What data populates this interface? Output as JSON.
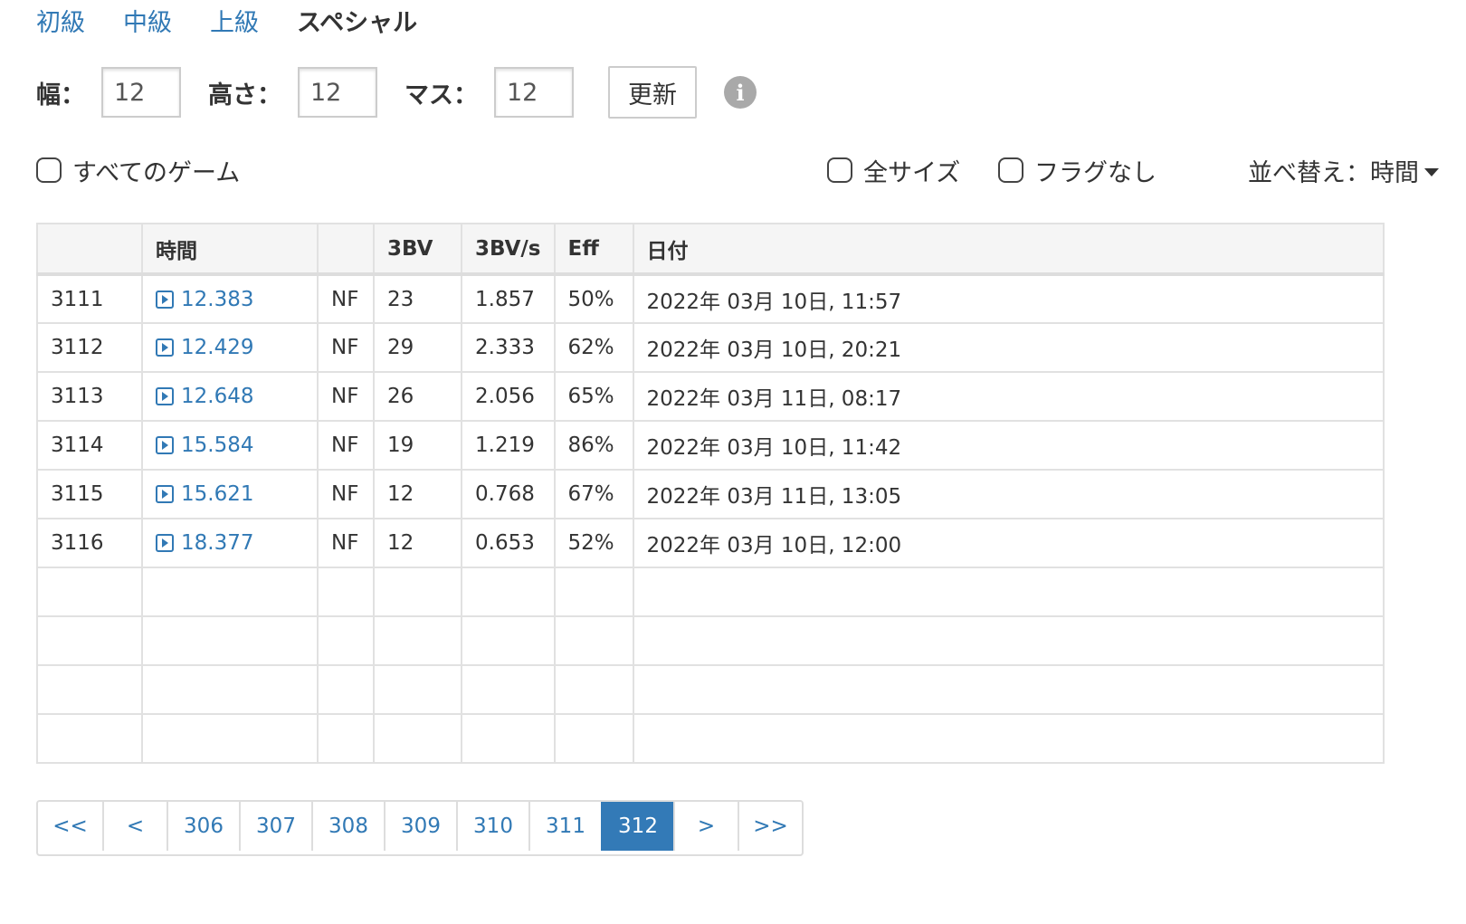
{
  "levels": [
    {
      "label": "初級",
      "active": false
    },
    {
      "label": "中級",
      "active": false
    },
    {
      "label": "上級",
      "active": false
    },
    {
      "label": "スペシャル",
      "active": true
    }
  ],
  "size_controls": {
    "width_label": "幅：",
    "width_value": "12",
    "height_label": "高さ：",
    "height_value": "12",
    "mines_label": "マス：",
    "mines_value": "12",
    "update_label": "更新",
    "info_icon": "info-circle-icon"
  },
  "filters": {
    "all_games_label": "すべてのゲーム",
    "all_games_checked": false,
    "all_sizes_label": "全サイズ",
    "all_sizes_checked": false,
    "no_flags_label": "フラグなし",
    "no_flags_checked": false,
    "sort_label": "並べ替え：時間"
  },
  "table": {
    "headers": [
      "",
      "時間",
      "",
      "3BV",
      "3BV/s",
      "Eff",
      "日付"
    ],
    "rows": [
      {
        "rank": "3111",
        "time": "12.383",
        "nf": "NF",
        "bv": "23",
        "bvs": "1.857",
        "eff": "50%",
        "date": "2022年 03月 10日, 11:57"
      },
      {
        "rank": "3112",
        "time": "12.429",
        "nf": "NF",
        "bv": "29",
        "bvs": "2.333",
        "eff": "62%",
        "date": "2022年 03月 10日, 20:21"
      },
      {
        "rank": "3113",
        "time": "12.648",
        "nf": "NF",
        "bv": "26",
        "bvs": "2.056",
        "eff": "65%",
        "date": "2022年 03月 11日, 08:17"
      },
      {
        "rank": "3114",
        "time": "15.584",
        "nf": "NF",
        "bv": "19",
        "bvs": "1.219",
        "eff": "86%",
        "date": "2022年 03月 10日, 11:42"
      },
      {
        "rank": "3115",
        "time": "15.621",
        "nf": "NF",
        "bv": "12",
        "bvs": "0.768",
        "eff": "67%",
        "date": "2022年 03月 11日, 13:05"
      },
      {
        "rank": "3116",
        "time": "18.377",
        "nf": "NF",
        "bv": "12",
        "bvs": "0.653",
        "eff": "52%",
        "date": "2022年 03月 10日, 12:00"
      }
    ],
    "empty_rows": 4
  },
  "pagination": {
    "first": "<<",
    "prev": "<",
    "pages": [
      "306",
      "307",
      "308",
      "309",
      "310",
      "311",
      "312"
    ],
    "current": "312",
    "next": ">",
    "last": ">>"
  },
  "colors": {
    "link": "#3179b5",
    "active_page": "#337ab7",
    "header_bg": "#f5f5f5",
    "border": "#e1e1e1"
  }
}
